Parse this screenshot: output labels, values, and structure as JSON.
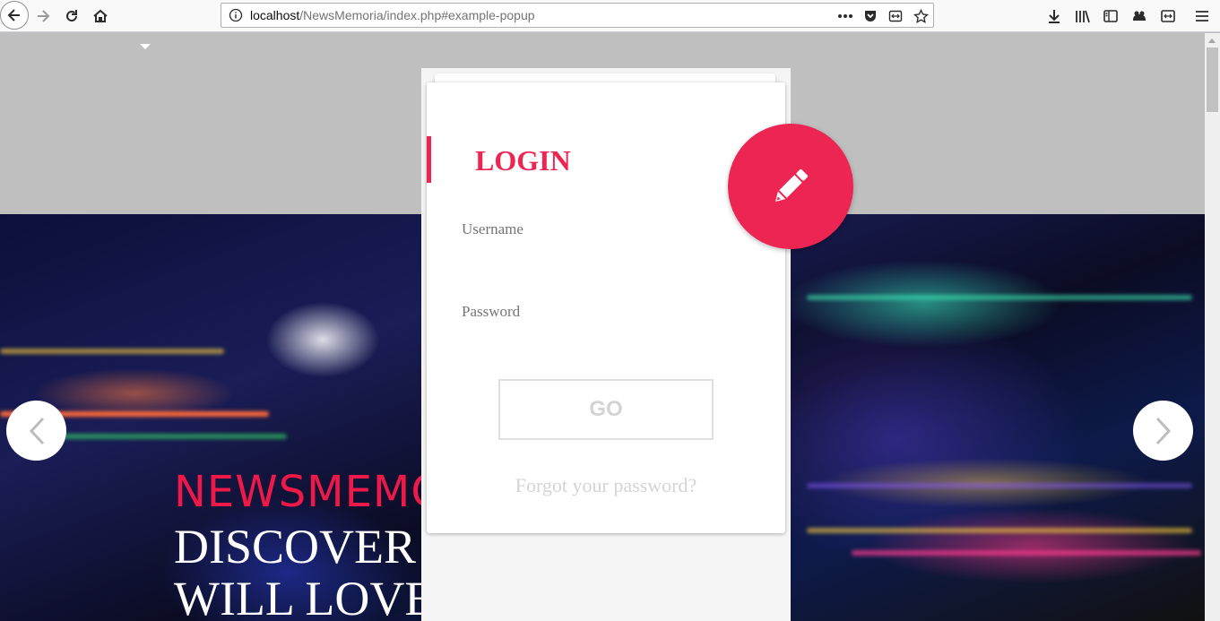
{
  "browser": {
    "url_host": "localhost",
    "url_path": "/NewsMemoria/index.php#example-popup",
    "icons": {
      "back": "back-arrow-icon",
      "forward": "forward-arrow-icon",
      "reload": "reload-icon",
      "home": "home-icon",
      "info": "info-icon",
      "more": "more-dots-icon",
      "pocket": "pocket-icon",
      "reader": "reader-view-icon",
      "bookmark": "bookmark-star-icon",
      "downloads": "download-icon",
      "library": "library-icon",
      "sidebar": "sidebar-icon",
      "extension": "extension-icon",
      "screenshot": "screenshot-icon",
      "menu": "hamburger-menu-icon"
    }
  },
  "hero": {
    "title_line1": "NEWSMEMO",
    "title_line2": "DISCOVER",
    "title_line3": "WILL LOVE"
  },
  "login": {
    "title": "LOGIN",
    "username_label": "Username",
    "password_label": "Password",
    "go_label": "GO",
    "forgot_label": "Forgot your password?"
  },
  "colors": {
    "accent": "#ed2553",
    "page_bg": "#bfbfbf"
  }
}
